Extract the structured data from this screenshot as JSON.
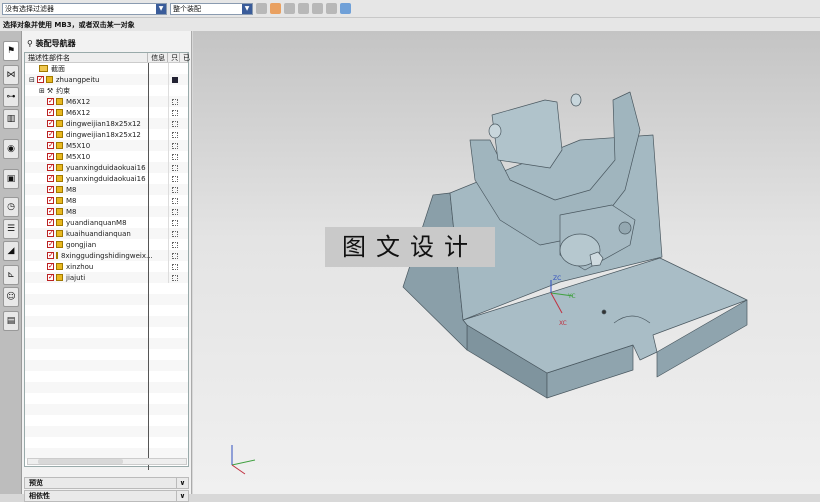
{
  "toolbar": {
    "filter": "没有选择过滤器",
    "scope": "整个装配"
  },
  "status": "选择对象并使用 MB3，或者双击某一对象",
  "nav": {
    "title": "装配导航器",
    "columns": [
      "描述性部件名",
      "信息",
      "只",
      "已"
    ],
    "rows": [
      {
        "name": "截面",
        "type": "folder",
        "level": 1
      },
      {
        "name": "zhuangpeitu",
        "type": "assembly",
        "level": 0
      },
      {
        "name": "约束",
        "type": "constraint",
        "level": 1
      },
      {
        "name": "M6X12"
      },
      {
        "name": "M6X12"
      },
      {
        "name": "dingweijian18x25x12"
      },
      {
        "name": "dingweijian18x25x12"
      },
      {
        "name": "M5X10"
      },
      {
        "name": "M5X10"
      },
      {
        "name": "yuanxingduidaokuai16"
      },
      {
        "name": "yuanxingduidaokuai16"
      },
      {
        "name": "M8"
      },
      {
        "name": "M8"
      },
      {
        "name": "M8"
      },
      {
        "name": "yuandianquanM8"
      },
      {
        "name": "kuaihuandianquan"
      },
      {
        "name": "gongjian"
      },
      {
        "name": "8xinggudingshidingweix..."
      },
      {
        "name": "xinzhou"
      },
      {
        "name": "jiajuti"
      }
    ],
    "sections": [
      "预览",
      "相依性"
    ]
  },
  "viewport": {
    "watermark": "图文设计",
    "axes": {
      "z": "ZC",
      "y": "YC",
      "x": "XC"
    }
  }
}
